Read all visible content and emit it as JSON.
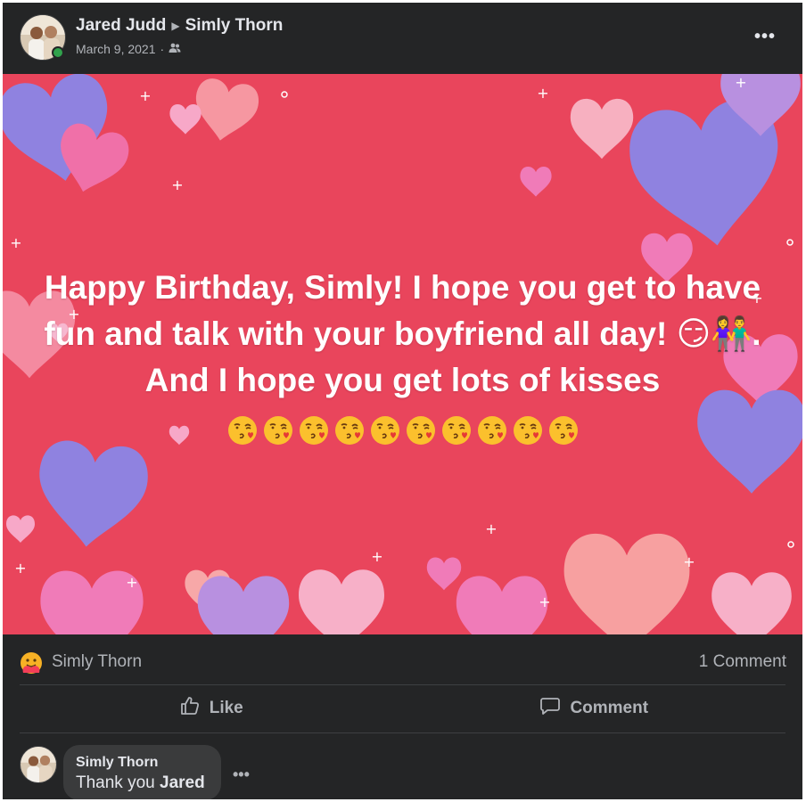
{
  "post": {
    "author": "Jared Judd",
    "recipient": "Simly Thorn",
    "date": "March 9, 2021",
    "date_separator": "·",
    "audience_icon": "friends-icon",
    "more_label": "•••",
    "message": "Happy Birthday, Simly! I hope you get to have fun and talk with your boyfriend all day! 😏👫. And I hope you get lots of kisses",
    "kiss_emoji_count_icon": "kissing-face-emoji",
    "background_color": "#e9455c"
  },
  "reactions": {
    "icon": "care-reaction-icon",
    "names": "Simly Thorn",
    "comment_count": "1 Comment"
  },
  "actions": {
    "like_label": "Like",
    "comment_label": "Comment"
  },
  "comment": {
    "author": "Simly Thorn",
    "text_prefix": "Thank you ",
    "text_name": "Jared",
    "more_label": "•••"
  },
  "colors": {
    "card": "#242526",
    "text_primary": "#e4e6eb",
    "text_secondary": "#b0b3b8",
    "bubble": "#3a3b3c",
    "online": "#31a24c"
  }
}
